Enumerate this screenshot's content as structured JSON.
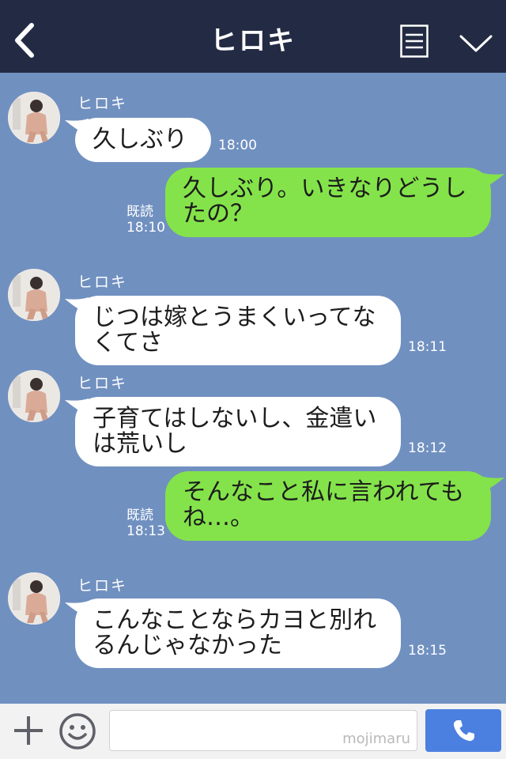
{
  "header": {
    "title": "ヒロキ"
  },
  "messages": {
    "m1": {
      "sender": "ヒロキ",
      "text": "久しぶり",
      "time": "18:00"
    },
    "m2": {
      "text": "久しぶり。いきなりどうしたの？",
      "read": "既読",
      "time": "18:10"
    },
    "m3": {
      "sender": "ヒロキ",
      "text": "じつは嫁とうまくいってなくてさ",
      "time": "18:11"
    },
    "m4": {
      "sender": "ヒロキ",
      "text": "子育てはしないし、金遣いは荒いし",
      "time": "18:12"
    },
    "m5": {
      "text": "そんなこと私に言われてもね…。",
      "read": "既読",
      "time": "18:13"
    },
    "m6": {
      "sender": "ヒロキ",
      "text": "こんなことならカヨと別れるんじゃなかった",
      "time": "18:15"
    }
  },
  "input": {
    "watermark": "mojimaru"
  },
  "colors": {
    "header_bg": "#232b44",
    "chat_bg": "#7090c0",
    "bubble_in": "#ffffff",
    "bubble_out": "#84e34a",
    "call_button": "#4c80e0"
  },
  "icons": [
    "back-icon",
    "menu-icon",
    "chevron-down-icon",
    "plus-icon",
    "smile-icon",
    "phone-icon"
  ]
}
